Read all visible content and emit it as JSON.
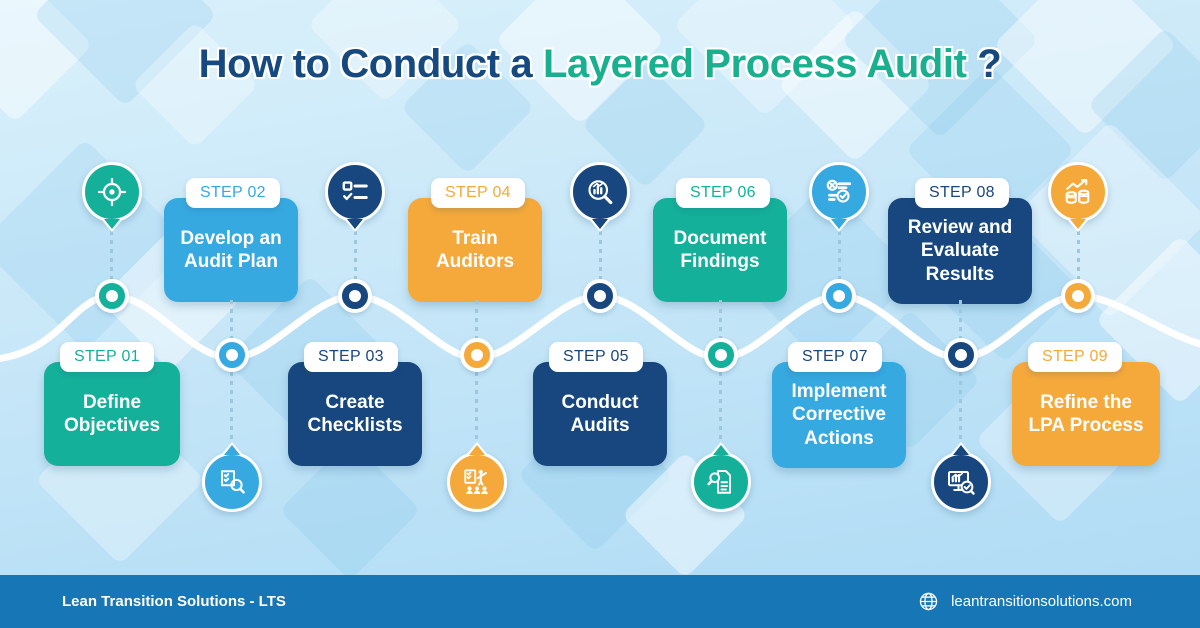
{
  "title": {
    "part1": "How to Conduct a ",
    "highlight": "Layered Process Audit",
    "part2": " ?"
  },
  "colors": {
    "teal": "#15b09a",
    "blue": "#36a9e1",
    "navy": "#17477e",
    "orange": "#f5a93b",
    "navy_dark": "#123a68",
    "footer": "#1676b6",
    "title_navy": "#15497f",
    "title_teal": "#19b08f"
  },
  "steps": [
    {
      "num": "STEP 01",
      "label": "Define\nObjectives",
      "color": "#15b09a",
      "icon": "target-icon"
    },
    {
      "num": "STEP 02",
      "label": "Develop an\nAudit Plan",
      "color": "#36a9e1",
      "icon": "audit-plan-icon"
    },
    {
      "num": "STEP 03",
      "label": "Create\nChecklists",
      "color": "#17477e",
      "icon": "checklist-icon"
    },
    {
      "num": "STEP 04",
      "label": "Train\nAuditors",
      "color": "#f5a93b",
      "icon": "training-icon"
    },
    {
      "num": "STEP 05",
      "label": "Conduct\nAudits",
      "color": "#17477e",
      "icon": "audit-search-icon"
    },
    {
      "num": "STEP 06",
      "label": "Document\nFindings",
      "color": "#15b09a",
      "icon": "document-search-icon"
    },
    {
      "num": "STEP 07",
      "label": "Implement\nCorrective\nActions",
      "color": "#36a9e1",
      "icon": "corrective-action-icon"
    },
    {
      "num": "STEP 08",
      "label": "Review and\nEvaluate\nResults",
      "color": "#17477e",
      "icon": "review-results-icon"
    },
    {
      "num": "STEP 09",
      "label": "Refine the\nLPA Process",
      "color": "#f5a93b",
      "icon": "growth-chart-icon"
    }
  ],
  "footer": {
    "brand": "Lean Transition Solutions - LTS",
    "website": "leantransitionsolutions.com",
    "globe_icon": "globe-icon"
  }
}
